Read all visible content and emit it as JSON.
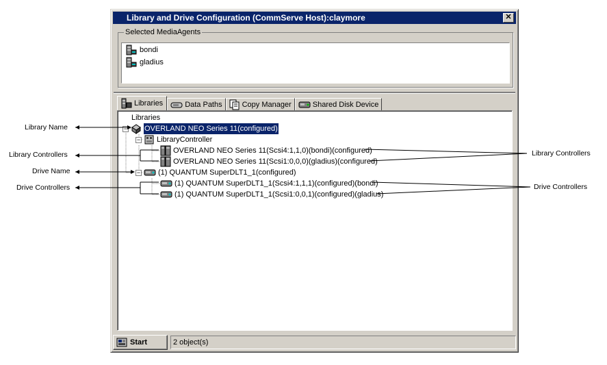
{
  "window": {
    "title": "Library and Drive Configuration (CommServe Host):claymore",
    "close_glyph": "✕"
  },
  "media_agents": {
    "group_label": "Selected MediaAgents",
    "items": [
      {
        "label": "bondi",
        "icon": "server-icon"
      },
      {
        "label": "gladius",
        "icon": "server-icon"
      }
    ]
  },
  "tabs": [
    {
      "label": "Libraries",
      "icon": "library-icon",
      "active": true
    },
    {
      "label": "Data Paths",
      "icon": "data-path-icon",
      "active": false
    },
    {
      "label": "Copy Manager",
      "icon": "copy-manager-icon",
      "active": false
    },
    {
      "label": "Shared Disk Device",
      "icon": "disk-device-icon",
      "active": false
    }
  ],
  "tree": {
    "root": "Libraries",
    "library": "OVERLAND NEO Series 11(configured)",
    "controller_group": "LibraryController",
    "controllers": [
      "OVERLAND NEO Series 11(Scsi4:1,1,0)(bondi)(configured)",
      "OVERLAND NEO Series 11(Scsi1:0,0,0)(gladius)(configured)"
    ],
    "drive": "(1) QUANTUM SuperDLT1_1(configured)",
    "drive_controllers": [
      "(1) QUANTUM SuperDLT1_1(Scsi4:1,1,1)(configured)(bondi)",
      "(1) QUANTUM SuperDLT1_1(Scsi1:0,0,1)(configured)(gladius)"
    ],
    "expand_glyph": "−"
  },
  "annotations": {
    "library_name": "Library Name",
    "library_controllers_left": "Library Controllers",
    "drive_name": "Drive Name",
    "drive_controllers_left": "Drive Controllers",
    "library_controllers_right": "Library Controllers",
    "drive_controllers_right": "Drive Controllers"
  },
  "statusbar": {
    "start_label": "Start",
    "status_text": "2 object(s)"
  },
  "colors": {
    "titlebar": "#0a246a",
    "face": "#d4d0c8",
    "selection": "#0a246a"
  }
}
